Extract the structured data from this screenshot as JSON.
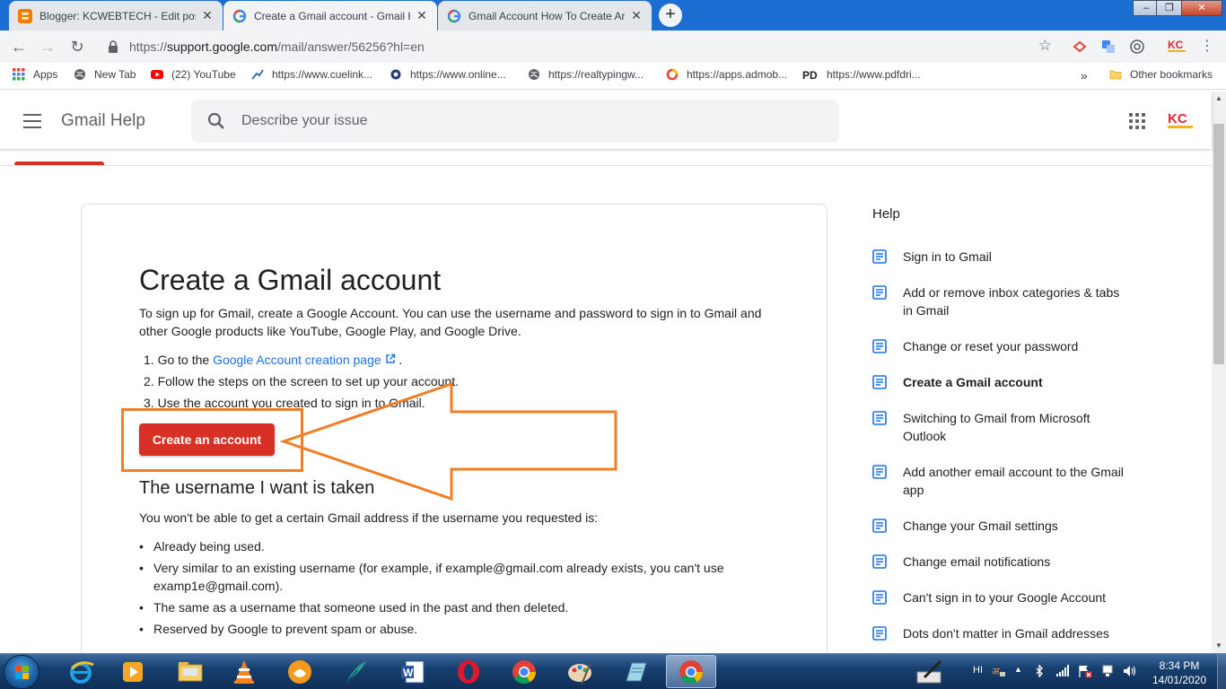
{
  "browser": {
    "tabs": [
      {
        "title": "Blogger: KCWEBTECH - Edit post",
        "icon": "blogger-icon",
        "active": false
      },
      {
        "title": "Create a Gmail account - Gmail H",
        "icon": "google-icon",
        "active": true
      },
      {
        "title": "Gmail Account How To Create Ar",
        "icon": "google-icon",
        "active": false
      }
    ],
    "new_tab": "+",
    "url_prefix": "https://",
    "url_domain": "support.google.com",
    "url_path": "/mail/answer/56256?hl=en",
    "bookmarks": [
      {
        "label": "Apps",
        "icon": "apps-grid-icon"
      },
      {
        "label": "New Tab",
        "icon": "globe-icon"
      },
      {
        "label": "(22) YouTube",
        "icon": "youtube-icon"
      },
      {
        "label": "https://www.cuelink...",
        "icon": "cuelinks-icon"
      },
      {
        "label": "https://www.online...",
        "icon": "online-icon"
      },
      {
        "label": "https://realtypingw...",
        "icon": "globe-icon"
      },
      {
        "label": "https://apps.admob...",
        "icon": "admob-icon"
      },
      {
        "label": "https://www.pdfdri...",
        "icon": "pdfdrive-icon"
      }
    ],
    "more_bookmarks": "»",
    "other_bookmarks": "Other bookmarks"
  },
  "header": {
    "title": "Gmail Help",
    "search_placeholder": "Describe your issue"
  },
  "article": {
    "title": "Create a Gmail account",
    "intro": "To sign up for Gmail, create a Google Account. You can use the username and password to sign in to Gmail and other Google products like YouTube, Google Play, and Google Drive.",
    "steps": [
      {
        "num": "1.",
        "before": "Go to the ",
        "link": "Google Account creation page",
        "after": "."
      },
      {
        "num": "2.",
        "text": "Follow the steps on the screen to set up your account."
      },
      {
        "num": "3.",
        "text": "Use the account you created to sign in to Gmail."
      }
    ],
    "button": "Create an account",
    "subheading": "The username I want is taken",
    "sub_intro": "You won't be able to get a certain Gmail address if the username you requested is:",
    "bullets": [
      "Already being used.",
      "Very similar to an existing username (for example, if example@gmail.com already exists, you can't use examp1e@gmail.com).",
      "The same as a username that someone used in the past and then deleted.",
      "Reserved by Google to prevent spam or abuse."
    ]
  },
  "sidebar": {
    "heading": "Help",
    "items": [
      {
        "label": "Sign in to Gmail",
        "current": false
      },
      {
        "label": "Add or remove inbox categories & tabs in Gmail",
        "current": false
      },
      {
        "label": "Change or reset your password",
        "current": false
      },
      {
        "label": "Create a Gmail account",
        "current": true
      },
      {
        "label": "Switching to Gmail from Microsoft Outlook",
        "current": false
      },
      {
        "label": "Add another email account to the Gmail app",
        "current": false
      },
      {
        "label": "Change your Gmail settings",
        "current": false
      },
      {
        "label": "Change email notifications",
        "current": false
      },
      {
        "label": "Can't sign in to your Google Account",
        "current": false
      },
      {
        "label": "Dots don't matter in Gmail addresses",
        "current": false
      }
    ]
  },
  "taskbar": {
    "language": "HI",
    "time": "8:34 PM",
    "date": "14/01/2020",
    "pinned": [
      "ie-icon",
      "media-player-icon",
      "file-explorer-icon",
      "vlc-icon",
      "uc-browser-icon",
      "quill-icon",
      "word-icon",
      "opera-icon",
      "chrome-icon",
      "paint-icon",
      "notepad-icon",
      "chrome-active-icon"
    ]
  },
  "colors": {
    "accent_red": "#d93025",
    "annotation_orange": "#f07e26",
    "link_blue": "#1a73e8",
    "tabstrip_blue": "#1d6ed2"
  }
}
